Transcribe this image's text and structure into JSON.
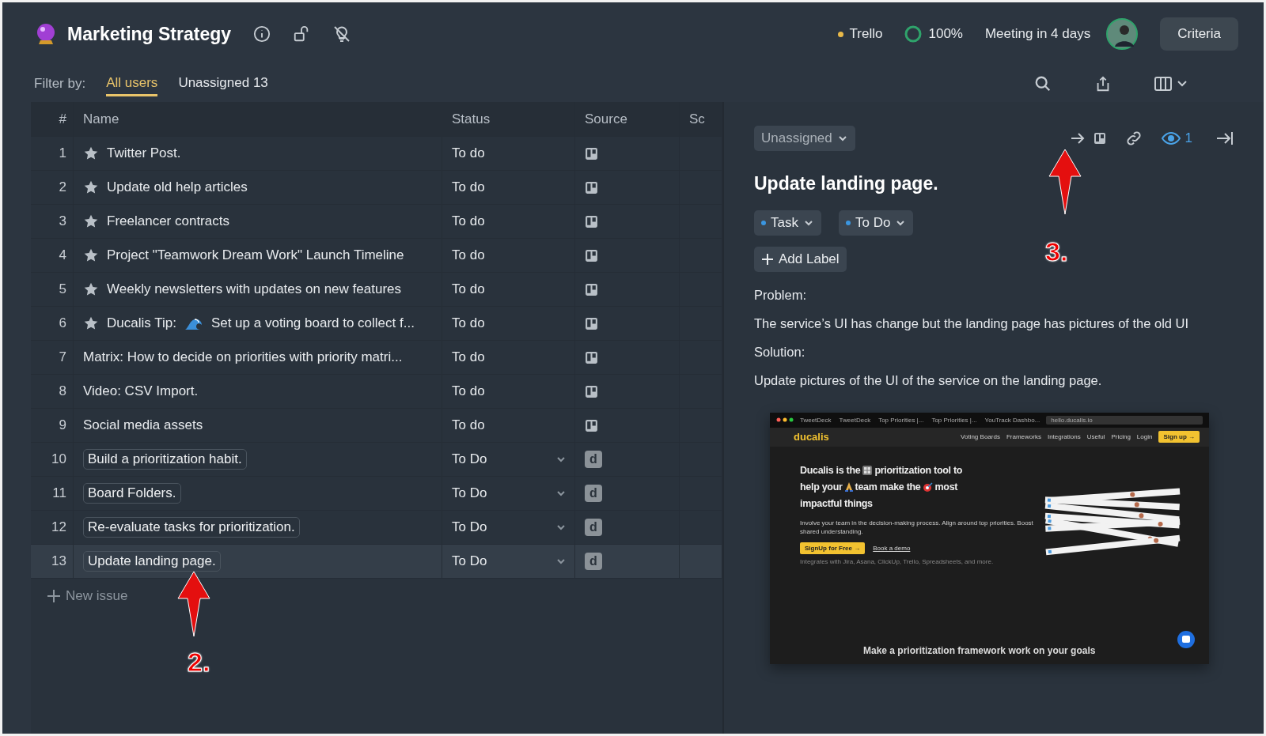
{
  "header": {
    "title": "Marketing Strategy",
    "integration": "Trello",
    "progress": "100%",
    "meeting": "Meeting in 4 days",
    "criteria_button": "Criteria"
  },
  "filter": {
    "label": "Filter by:",
    "options": [
      {
        "label": "All users",
        "selected": true
      },
      {
        "label": "Unassigned 13",
        "selected": false
      }
    ]
  },
  "table": {
    "columns": [
      "#",
      "Name",
      "Status",
      "Source",
      "Sc"
    ],
    "rows": [
      {
        "number": "1",
        "name": "Twitter Post.",
        "starred": true,
        "status": "To do",
        "kind": "trello",
        "selected": false
      },
      {
        "number": "2",
        "name": "Update old help articles",
        "starred": true,
        "status": "To do",
        "kind": "trello",
        "selected": false
      },
      {
        "number": "3",
        "name": "Freelancer contracts",
        "starred": true,
        "status": "To do",
        "kind": "trello",
        "selected": false
      },
      {
        "number": "4",
        "name": "Project \"Teamwork Dream Work\" Launch Timeline",
        "starred": true,
        "status": "To do",
        "kind": "trello",
        "selected": false
      },
      {
        "number": "5",
        "name": "Weekly newsletters with updates on new features",
        "starred": true,
        "status": "To do",
        "kind": "trello",
        "selected": false
      },
      {
        "number": "6",
        "name_parts": [
          "Ducalis Tip:",
          "Set up a voting board to collect f..."
        ],
        "starred": true,
        "status": "To do",
        "kind": "trello",
        "selected": false
      },
      {
        "number": "7",
        "name": "Matrix: How to decide on priorities with priority matri...",
        "starred": false,
        "status": "To do",
        "kind": "trello",
        "selected": false
      },
      {
        "number": "8",
        "name": "Video: CSV Import.",
        "starred": false,
        "status": "To do",
        "kind": "trello",
        "selected": false
      },
      {
        "number": "9",
        "name": "Social media assets",
        "starred": false,
        "status": "To do",
        "kind": "trello",
        "selected": false
      },
      {
        "number": "10",
        "name": "Build a prioritization habit.",
        "starred": false,
        "status": "To Do",
        "kind": "ducalis",
        "source": "d",
        "selected": false
      },
      {
        "number": "11",
        "name": "Board Folders.",
        "starred": false,
        "status": "To Do",
        "kind": "ducalis",
        "source": "d",
        "selected": false
      },
      {
        "number": "12",
        "name": "Re-evaluate tasks for prioritization.",
        "starred": false,
        "status": "To Do",
        "kind": "ducalis",
        "source": "d",
        "selected": false
      },
      {
        "number": "13",
        "name": "Update landing page.",
        "starred": false,
        "status": "To Do",
        "kind": "ducalis",
        "source": "d",
        "selected": true
      }
    ],
    "new_issue": "New issue"
  },
  "detail": {
    "assignee": "Unassigned",
    "watchers": "1",
    "title": "Update landing page.",
    "type": "Task",
    "status": "To Do",
    "add_label": "Add Label",
    "paragraphs": [
      "Problem:",
      "The service’s UI has change but the landing page has pictures of the old UI",
      "Solution:",
      "Update pictures of the UI of the service on the landing page."
    ],
    "screenshot": {
      "tabs": [
        "TweetDeck",
        "TweetDeck",
        "Top Priorities |...",
        "Top Priorities |...",
        "YouTrack Dashbo..."
      ],
      "address": "hello.ducalis.io",
      "logo": "ducalis",
      "nav": [
        "Voting Boards",
        "Frameworks",
        "Integrations",
        "Useful",
        "Pricing",
        "Login"
      ],
      "signup": "Sign up →",
      "headline_lines": [
        [
          "Ducalis is the",
          "prioritization tool to"
        ],
        [
          "help your",
          "team make the",
          "most"
        ],
        [
          "impactful things"
        ]
      ],
      "subtitle": "Involve your team in the decision-making process. Align around top priorities. Boost shared understanding.",
      "cta": "SignUp for Free →",
      "demo": "Book a demo",
      "integrations": "Integrates with  Jira,  Asana,  ClickUp,  Trello,  Spreadsheets, and more.",
      "section_heading": "Make a prioritization framework work on your goals"
    }
  },
  "annotations": [
    {
      "label": "2."
    },
    {
      "label": "3."
    }
  ]
}
